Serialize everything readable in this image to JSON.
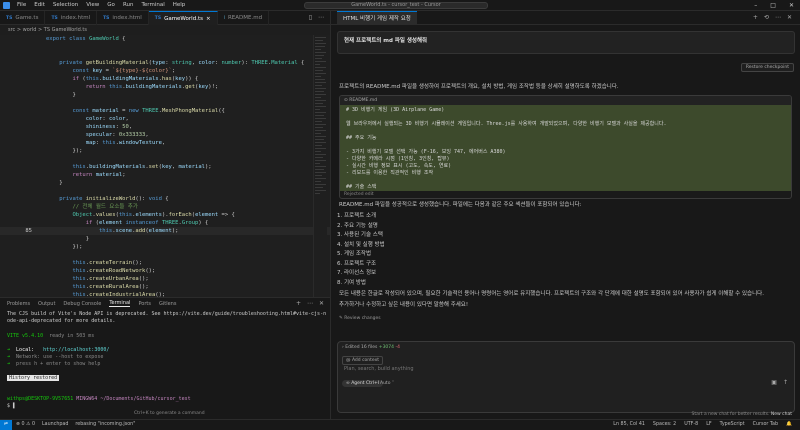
{
  "titlebar": {
    "menus": [
      "File",
      "Edit",
      "Selection",
      "View",
      "Go",
      "Run",
      "Terminal",
      "Help"
    ],
    "search": "GameWorld.ts - cursor_test - Cursor"
  },
  "tabs": [
    {
      "icon": "TS",
      "label": "Game.ts",
      "active": false
    },
    {
      "icon": "TS",
      "label": "index.html",
      "active": false
    },
    {
      "icon": "TS",
      "label": "index.html",
      "active": false
    },
    {
      "icon": "TS",
      "label": "GameWorld.ts",
      "active": true
    },
    {
      "icon": "i",
      "label": "README.md",
      "active": false
    }
  ],
  "breadcrumb": "src > world > TS GameWorld.ts",
  "editor": {
    "current_line": "85",
    "lines": [
      {
        "n": "",
        "html": "<span class='k'>export class</span> <span class='ty'>GameWorld</span> {"
      },
      {
        "n": "",
        "html": ""
      },
      {
        "n": "",
        "html": ""
      },
      {
        "n": "",
        "html": "    <span class='k'>private</span> <span class='f'>getBuildingMaterial</span>(<span class='v'>type</span>: <span class='ty'>string</span>, <span class='v'>color</span>: <span class='ty'>number</span>): <span class='ty'>THREE</span>.<span class='ty'>Material</span> {"
      },
      {
        "n": "",
        "html": "        <span class='k'>const</span> <span class='v'>key</span> = <span class='s'>`${type}-${color}`</span>;"
      },
      {
        "n": "",
        "html": "        <span class='kc'>if</span> (<span class='k'>this</span>.<span class='v'>buildingMaterials</span>.<span class='f'>has</span>(<span class='v'>key</span>)) {"
      },
      {
        "n": "",
        "html": "            <span class='kc'>return</span> <span class='k'>this</span>.<span class='v'>buildingMaterials</span>.<span class='f'>get</span>(<span class='v'>key</span>)!;"
      },
      {
        "n": "",
        "html": "        }"
      },
      {
        "n": "",
        "html": ""
      },
      {
        "n": "",
        "html": "        <span class='k'>const</span> <span class='v'>material</span> = <span class='k'>new</span> <span class='ty'>THREE</span>.<span class='f'>MeshPhongMaterial</span>({"
      },
      {
        "n": "",
        "html": "            <span class='v'>color</span>: <span class='v'>color</span>,"
      },
      {
        "n": "",
        "html": "            <span class='v'>shininess</span>: <span class='n'>50</span>,"
      },
      {
        "n": "",
        "html": "            <span class='v'>specular</span>: <span class='n'>0x333333</span>,"
      },
      {
        "n": "",
        "html": "            <span class='v'>map</span>: <span class='k'>this</span>.<span class='v'>windowTexture</span>,"
      },
      {
        "n": "",
        "html": "        });"
      },
      {
        "n": "",
        "html": ""
      },
      {
        "n": "",
        "html": "        <span class='k'>this</span>.<span class='v'>buildingMaterials</span>.<span class='f'>set</span>(<span class='v'>key</span>, <span class='v'>material</span>);"
      },
      {
        "n": "",
        "html": "        <span class='kc'>return</span> <span class='v'>material</span>;"
      },
      {
        "n": "",
        "html": "    }"
      },
      {
        "n": "",
        "html": ""
      },
      {
        "n": "",
        "html": "    <span class='k'>private</span> <span class='f'>initializeWorld</span>(): <span class='k'>void</span> {"
      },
      {
        "n": "",
        "html": "        <span class='c'>// 전체 월드 요소들 추가</span>"
      },
      {
        "n": "",
        "html": "        <span class='ty'>Object</span>.<span class='f'>values</span>(<span class='k'>this</span>.<span class='v'>elements</span>).<span class='f'>forEach</span>(<span class='v'>element</span> => {"
      },
      {
        "n": "",
        "html": "            <span class='kc'>if</span> (<span class='v'>element</span> <span class='k'>instanceof</span> <span class='ty'>THREE</span>.<span class='ty'>Group</span>) {"
      },
      {
        "n": "85",
        "html": "                <span class='k'>this</span>.<span class='v'>scene</span>.<span class='f'>add</span>(<span class='v'>element</span>);"
      },
      {
        "n": "",
        "html": "            }"
      },
      {
        "n": "",
        "html": "        });"
      },
      {
        "n": "",
        "html": ""
      },
      {
        "n": "",
        "html": "        <span class='k'>this</span>.<span class='f'>createTerrain</span>();"
      },
      {
        "n": "",
        "html": "        <span class='k'>this</span>.<span class='f'>createRoadNetwork</span>();"
      },
      {
        "n": "",
        "html": "        <span class='k'>this</span>.<span class='f'>createUrbanArea</span>();"
      },
      {
        "n": "",
        "html": "        <span class='k'>this</span>.<span class='f'>createRuralArea</span>();"
      },
      {
        "n": "",
        "html": "        <span class='k'>this</span>.<span class='f'>createIndustrialArea</span>();"
      }
    ]
  },
  "panel": {
    "tabs": [
      "Problems",
      "Output",
      "Debug Console",
      "Terminal",
      "Ports",
      "Gitlens"
    ],
    "active_tab": "Terminal",
    "terminal": {
      "warning": "The CJS build of Vite's Node API is deprecated. See https://vite.dev/guide/troubleshooting.html#vite-cjs-n\node-api-deprecated for more details.",
      "vite_version": "VITE v5.4.10",
      "ready": "ready in 503 ms",
      "local_label": "Local:",
      "local_url": "http://localhost:3000/",
      "network": "Network: use --host to expose",
      "help": "press h + enter to show help",
      "history": "History restored",
      "prompt_user": "withps@DESKTOP-9V57651",
      "prompt_path": "MINGW64 ~/Documents/GitHub/cursor_test",
      "prompt_symbol": "$"
    },
    "hint": "Ctrl+K to generate a command"
  },
  "chat": {
    "title": "HTML 비행기 게임 제작 요청",
    "user_message": "현재 프로젝트의 md 파일 생성해줘",
    "restore_label": "Restore checkpoint",
    "intro": "프로젝트의 README.md 파일을 생성하여 프로젝트의 개요, 설치 방법, 게임 조작법 등을 상세히 설명하도록 하겠습니다.",
    "code_card": {
      "file": "README.md",
      "lines": [
        "# 3D 비행기 게임 (3D Airplane Game)",
        "",
        "웹 브라우저에서 실행되는 3D 비행기 시뮬레이션 게임입니다. Three.js를 사용하여 개발되었으며, 다양한 비행기 모델과 사실을 제공합니다.",
        "",
        "## 주요 기능",
        "",
        "- 3가지 비행기 모델 선택 가능 (F-16, 보잉 747, 에어버스 A380)",
        "- 다양한 카메라 시점 (1인칭, 3인칭, 탑뷰)",
        "- 실시간 비행 정보 표시 (고도, 속도, 연료)",
        "- 리보드를 이용한 직관적인 비행 조작",
        "",
        "## 기술 스택"
      ],
      "footer": "Rejected edit"
    },
    "summary": "README.md 파일을 성공적으로 생성했습니다. 파일에는 다음과 같은 주요 섹션들이 포함되어 있습니다:",
    "sections": [
      "1. 프로젝트 소개",
      "2. 주요 기능 설명",
      "3. 사용된 기술 스택",
      "4. 설치 및 실행 방법",
      "5. 게임 조작법",
      "6. 프로젝트 구조",
      "7. 라이선스 정보",
      "8. 기여 방법"
    ],
    "closing_1": "모든 내용은 한글로 작성되어 있으며, 필요한 기술적인 용어나 명령어는 영어로 유지했습니다. 프로젝트의 구조와 각 단계에 대한 설명도 포함되어 있어 사용자가 쉽게 이해할 수 있습니다.",
    "closing_2": "추가하거나 수정하고 싶은 내용이 있다면 말씀해 주세요!",
    "review_label": "Review changes",
    "composer": {
      "edited_label": "Edited 16 files",
      "plus": "+3074",
      "minus": "-4",
      "add_context": "Add context",
      "placeholder": "Plan, search, build anything",
      "mode": "Agent",
      "mode_shortcut": "Ctrl+I",
      "model": "Auto"
    },
    "new_chat_hint": "Start a new chat for better results.",
    "new_chat_label": "New chat"
  },
  "statusbar": {
    "left": [
      "⊗ 0 ⚠ 0",
      "Launchpad",
      "rebasing \"incoming.json\""
    ],
    "right": [
      "Ln 85, Col 41",
      "Spaces: 2",
      "UTF-8",
      "LF",
      "TypeScript",
      "Cursor Tab",
      "🔔"
    ]
  }
}
